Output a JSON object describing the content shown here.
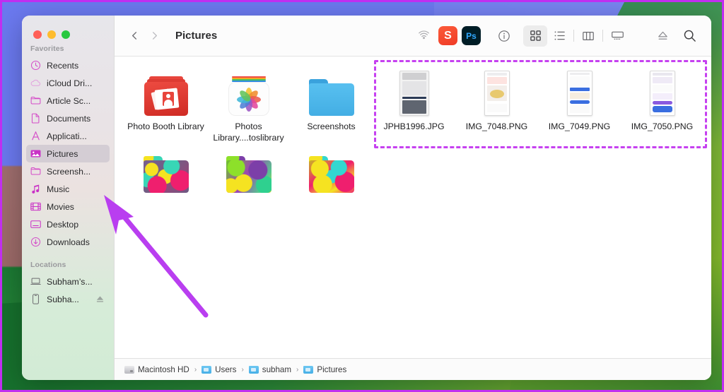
{
  "window": {
    "title": "Pictures",
    "traffic_lights": [
      "close-red",
      "minimize-yellow",
      "zoom-green"
    ],
    "colors": {
      "close": "#ff5f57",
      "minimize": "#febc2e",
      "zoom": "#28c840",
      "annotation": "#c641f0",
      "selection": "#d4cdd4"
    }
  },
  "toolbar": {
    "back_icon": "chevron-left-icon",
    "forward_icon": "chevron-right-icon",
    "title": "Pictures",
    "airdrop_icon": "airdrop-icon",
    "apps": [
      {
        "name": "setapp-app-icon",
        "label": "S"
      },
      {
        "name": "photoshop-app-icon",
        "label": "Ps"
      }
    ],
    "view_buttons": [
      {
        "name": "info-button",
        "icon": "info-circle-icon",
        "active": false
      },
      {
        "name": "icon-view-button",
        "icon": "grid-view-icon",
        "active": true
      },
      {
        "name": "list-view-button",
        "icon": "list-view-icon",
        "active": false
      },
      {
        "name": "column-view-button",
        "icon": "column-view-icon",
        "active": false
      },
      {
        "name": "gallery-view-button",
        "icon": "gallery-view-icon",
        "active": false
      }
    ],
    "eject_icon": "eject-icon",
    "search_icon": "search-icon"
  },
  "sidebar": {
    "sections": [
      {
        "heading": "Favorites",
        "items": [
          {
            "label": "Recents",
            "icon": "clock-icon",
            "selected": false
          },
          {
            "label": "iCloud Dri...",
            "icon": "cloud-icon",
            "selected": false
          },
          {
            "label": "Article Sc...",
            "icon": "folder-icon",
            "selected": false
          },
          {
            "label": "Documents",
            "icon": "document-icon",
            "selected": false
          },
          {
            "label": "Applicati...",
            "icon": "applications-icon",
            "selected": false
          },
          {
            "label": "Pictures",
            "icon": "pictures-icon",
            "selected": true
          },
          {
            "label": "Screensh...",
            "icon": "folder-icon",
            "selected": false
          },
          {
            "label": "Music",
            "icon": "music-note-icon",
            "selected": false
          },
          {
            "label": "Movies",
            "icon": "film-icon",
            "selected": false
          },
          {
            "label": "Desktop",
            "icon": "desktop-icon",
            "selected": false
          },
          {
            "label": "Downloads",
            "icon": "download-icon",
            "selected": false
          }
        ]
      },
      {
        "heading": "Locations",
        "items": [
          {
            "label": "Subham’s...",
            "icon": "laptop-icon",
            "selected": false,
            "eject": false
          },
          {
            "label": "Subha...",
            "icon": "iphone-icon",
            "selected": false,
            "eject": true
          }
        ]
      }
    ]
  },
  "files": [
    {
      "name": "Photo Booth Library",
      "icon": "photo-booth-library-icon",
      "selected": false
    },
    {
      "name": "Photos Library....toslibrary",
      "icon": "photos-library-icon",
      "selected": false
    },
    {
      "name": "Screenshots",
      "icon": "blue-folder-icon",
      "selected": false
    },
    {
      "name": "JPHB1996.JPG",
      "icon": "image-thumbnail-icon",
      "selected": false
    },
    {
      "name": "IMG_7048.PNG",
      "icon": "image-thumbnail-icon",
      "selected": false
    },
    {
      "name": "IMG_7049.PNG",
      "icon": "image-thumbnail-icon",
      "selected": false
    },
    {
      "name": "IMG_7050.PNG",
      "icon": "image-thumbnail-icon",
      "selected": false
    },
    {
      "name": "",
      "icon": "patterned-folder-icon",
      "selected": false
    },
    {
      "name": "",
      "icon": "patterned-folder-icon",
      "selected": false
    },
    {
      "name": "",
      "icon": "patterned-folder-icon",
      "selected": false
    }
  ],
  "path_bar": {
    "crumbs": [
      {
        "label": "Macintosh HD",
        "icon": "hard-disk-icon"
      },
      {
        "label": "Users",
        "icon": "folder-icon"
      },
      {
        "label": "subham",
        "icon": "folder-icon"
      },
      {
        "label": "Pictures",
        "icon": "folder-icon"
      }
    ],
    "separator": "›"
  },
  "annotations": {
    "highlight_box": "dashed-highlight-rectangle",
    "pointer": "arrow-pointing-to-pictures"
  }
}
